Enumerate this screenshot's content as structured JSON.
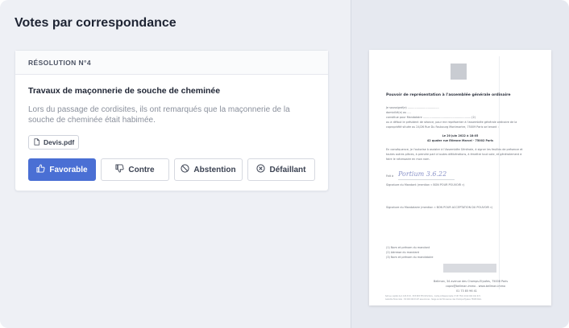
{
  "page_title": "Votes par correspondance",
  "resolution": {
    "header": "RÉSOLUTION N°4",
    "title": "Travaux de maçonnerie de souche de cheminée",
    "description": "Lors du passage de cordisites,  ils ont remarqués que la maçonnerie de la souche de cheminée était habimée.",
    "attachment": "Devis.pdf"
  },
  "actions": {
    "favorable": "Favorable",
    "contre": "Contre",
    "abstention": "Abstention",
    "defaillant": "Défaillant"
  },
  "colors": {
    "primary": "#4a6fd4",
    "panel_bg": "#eef0f5",
    "preview_bg": "#e6e9f0"
  },
  "document_preview": {
    "title": "Pouvoir de représentation à l'assemblée générale ordinaire",
    "undersigned": "Je soussigné(e) ....................................",
    "domicile": "domicilié(e) au ....",
    "constitue": "constitue pour Mandataire .......................................................  (2)",
    "president": "ou à défaut le président de séance, pour me représenter à l'assemblée générale ordinaire de la",
    "copropriete": "copropriété située au 24/26 Rue Du Faubourg Montmartre, 75009 Paris se tenant :",
    "date": "Le 20 juin 2022 à 18:05",
    "address": "42 quater rue Etienne Marcel - 75002 Paris",
    "consequence1": "En conséquence, je l'autorise à assister à l'Assemblée Générale, à signer les feuilles de présence et",
    "consequence2": "toutes autres pièces, à prendre part à toutes délibérations, à émettre tout vote, et généralement à",
    "consequence3": "faire le nécessaire en mon nom.",
    "fait_a": "Fait à",
    "handwriting": "Portium  3.6.22",
    "sig_mandant": "Signature du Mandant (mention « BON POUR POUVOIR »)",
    "sig_mandataire": "Signature du Mandataire (mention « BON POUR ACCEPTATION DU POUVOIR »)",
    "footnote1": "(1) Nom et prénom du mandant",
    "footnote2": "(2) Adresse du mandant",
    "footnote3": "(3) Nom et prénom du mandataire",
    "footer1": "Bellman, 34 avenue des Champs-Elysées, 75008 Paris",
    "footer2": "copro@bellman.immo - www.bellman.immo",
    "footer3": "01 73 85 96 41",
    "legal1": "SAS au capital de 4 105,33 € - 835 895 555 RCS Paris - Carte professionnelle n°CPI 7501 2019 000 041 671",
    "legal2": "Garantie financière : 30 000 000 € GTI assurances - Siège social 84 avenue des Champs-Elysées 75008 Paris"
  }
}
